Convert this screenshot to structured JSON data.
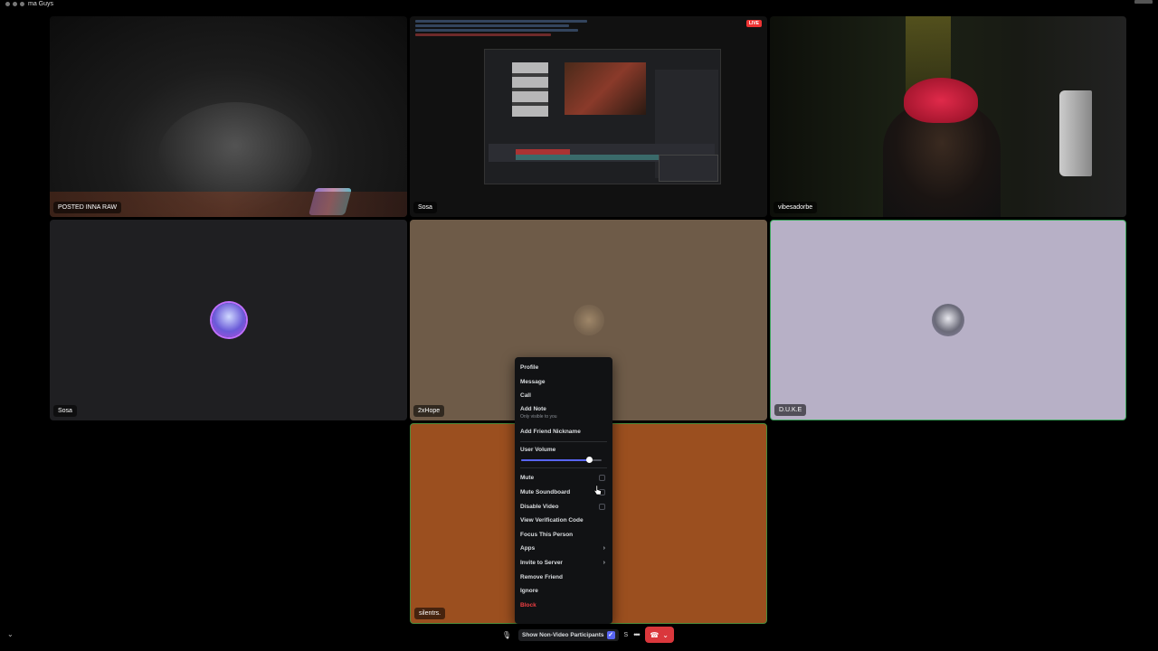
{
  "window": {
    "title": "ma Guys"
  },
  "tiles": [
    {
      "name": "POSTED INNA RAW"
    },
    {
      "name": "Sosa",
      "badge": "LIVE"
    },
    {
      "name": "vibesadorbe"
    },
    {
      "name": "Sosa"
    },
    {
      "name": "2xHope"
    },
    {
      "name": "D.U.K.E"
    },
    {
      "name": "silentrs."
    }
  ],
  "context_menu": {
    "items": [
      {
        "label": "Profile"
      },
      {
        "label": "Message"
      },
      {
        "label": "Call"
      },
      {
        "label": "Add Note",
        "sub": "Only visible to you"
      },
      {
        "label": "Add Friend Nickname"
      }
    ],
    "user_volume": {
      "label": "User Volume",
      "value": 0.85
    },
    "toggles": [
      {
        "label": "Mute",
        "checked": false
      },
      {
        "label": "Mute Soundboard",
        "checked": false
      },
      {
        "label": "Disable Video",
        "checked": false
      }
    ],
    "more": [
      {
        "label": "View Verification Code"
      },
      {
        "label": "Focus This Person"
      },
      {
        "label": "Apps"
      },
      {
        "label": "Invite to Server"
      },
      {
        "label": "Remove Friend"
      },
      {
        "label": "Ignore"
      },
      {
        "label": "Block"
      }
    ]
  },
  "bottom_bar": {
    "show_non_video": "Show Non-Video Participants",
    "show_non_video_checked": true,
    "s_label": "S"
  },
  "colors": {
    "accent": "#5865f2",
    "danger": "#f23f43",
    "end_call": "#da373c",
    "speaking_border": "#3ba55c"
  },
  "icons": [
    "mic-icon",
    "checkbox-icon",
    "more-icon",
    "hangup-icon",
    "chevron-down-icon",
    "chevron-right-icon",
    "pointer-cursor-icon"
  ]
}
